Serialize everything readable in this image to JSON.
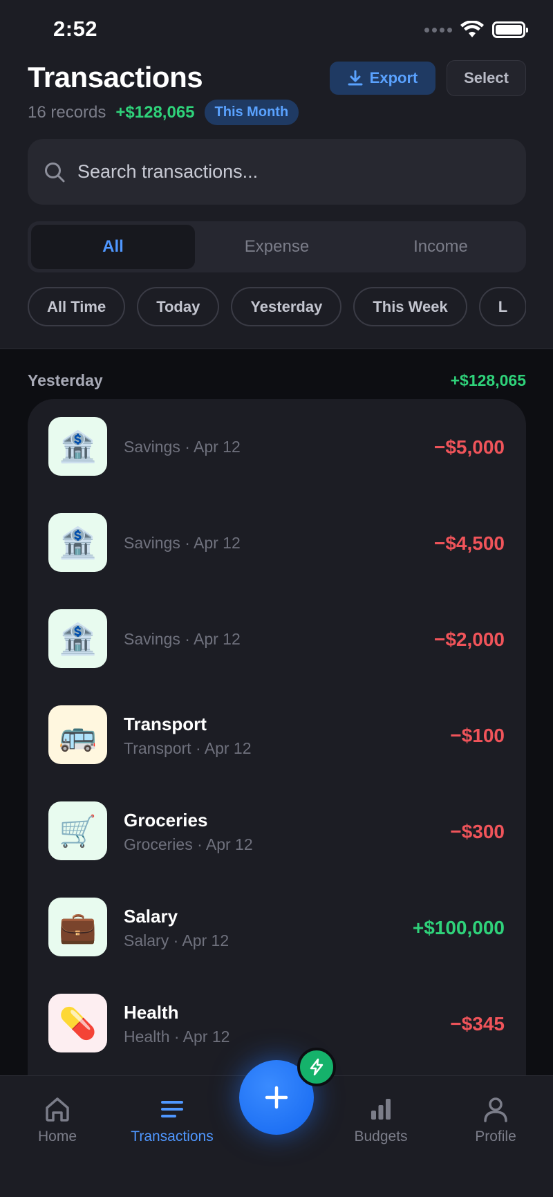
{
  "status": {
    "time": "2:52"
  },
  "header": {
    "title": "Transactions",
    "export_label": "Export",
    "select_label": "Select",
    "records": "16 records",
    "total": "+$128,065",
    "period_badge": "This Month"
  },
  "search": {
    "placeholder": "Search transactions..."
  },
  "segments": [
    {
      "label": "All"
    },
    {
      "label": "Expense"
    },
    {
      "label": "Income"
    }
  ],
  "chips": [
    {
      "label": "All Time"
    },
    {
      "label": "Today"
    },
    {
      "label": "Yesterday"
    },
    {
      "label": "This Week"
    },
    {
      "label": "L"
    }
  ],
  "section": {
    "title": "Yesterday",
    "total": "+$128,065"
  },
  "transactions": [
    {
      "name": "",
      "meta": "Savings · Apr 12",
      "amount": "−$5,000",
      "icon": "bank-icon",
      "glyph": "🏦",
      "bg": "#e8fbef",
      "type": "expense"
    },
    {
      "name": "",
      "meta": "Savings · Apr 12",
      "amount": "−$4,500",
      "icon": "bank-icon",
      "glyph": "🏦",
      "bg": "#e8fbef",
      "type": "expense"
    },
    {
      "name": "",
      "meta": "Savings · Apr 12",
      "amount": "−$2,000",
      "icon": "bank-icon",
      "glyph": "🏦",
      "bg": "#e8fbef",
      "type": "expense"
    },
    {
      "name": "Transport",
      "meta": "Transport · Apr 12",
      "amount": "−$100",
      "icon": "bus-icon",
      "glyph": "🚌",
      "bg": "#fff7df",
      "type": "expense"
    },
    {
      "name": "Groceries",
      "meta": "Groceries · Apr 12",
      "amount": "−$300",
      "icon": "cart-icon",
      "glyph": "🛒",
      "bg": "#e8fbef",
      "type": "expense"
    },
    {
      "name": "Salary",
      "meta": "Salary · Apr 12",
      "amount": "+$100,000",
      "icon": "briefcase-icon",
      "glyph": "💼",
      "bg": "#e8fbef",
      "type": "income"
    },
    {
      "name": "Health",
      "meta": "Health · Apr 12",
      "amount": "−$345",
      "icon": "pill-icon",
      "glyph": "💊",
      "bg": "#fdeef1",
      "type": "expense"
    }
  ],
  "nav": {
    "home": "Home",
    "transactions": "Transactions",
    "budgets": "Budgets",
    "profile": "Profile"
  },
  "colors": {
    "accent": "#4f97ff",
    "income": "#2fd27a",
    "expense": "#f0545a",
    "background": "#0d0e12",
    "surface": "#1c1d24"
  }
}
